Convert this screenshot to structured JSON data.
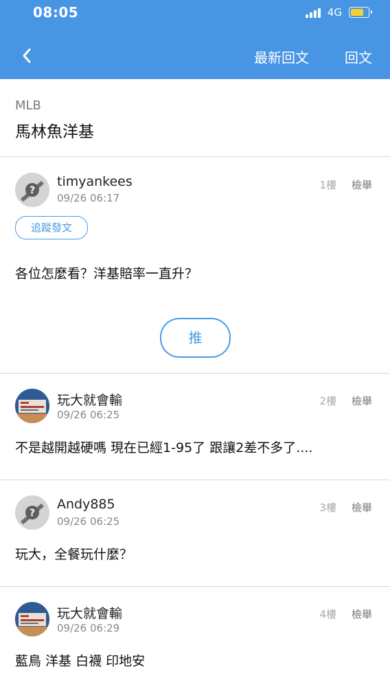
{
  "status_bar": {
    "time": "08:05",
    "network": "4G"
  },
  "header": {
    "latest_replies": "最新回文",
    "reply": "回文"
  },
  "board": "MLB",
  "thread_title": "馬林魚洋基",
  "follow_label": "追蹤發文",
  "push_label": "推",
  "report_label": "檢舉",
  "posts": [
    {
      "user": "timyankees",
      "time": "09/26 06:17",
      "floor": "1樓",
      "content": "各位怎麼看？洋基賠率一直升？",
      "avatar": "default"
    },
    {
      "user": "玩大就會輸",
      "time": "09/26 06:25",
      "floor": "2樓",
      "content": "不是越開越硬嗎 現在已經1-95了 跟讓2差不多了....",
      "avatar": "photo"
    },
    {
      "user": "Andy885",
      "time": "09/26 06:25",
      "floor": "3樓",
      "content": "玩大，全餐玩什麼？",
      "avatar": "default"
    },
    {
      "user": "玩大就會輸",
      "time": "09/26 06:29",
      "floor": "4樓",
      "content": "藍鳥 洋基 白襪 印地安",
      "avatar": "photo"
    }
  ],
  "colors": {
    "header_bg": "#4895e4",
    "accent": "#4a9ae6",
    "battery": "#f4d12e"
  }
}
